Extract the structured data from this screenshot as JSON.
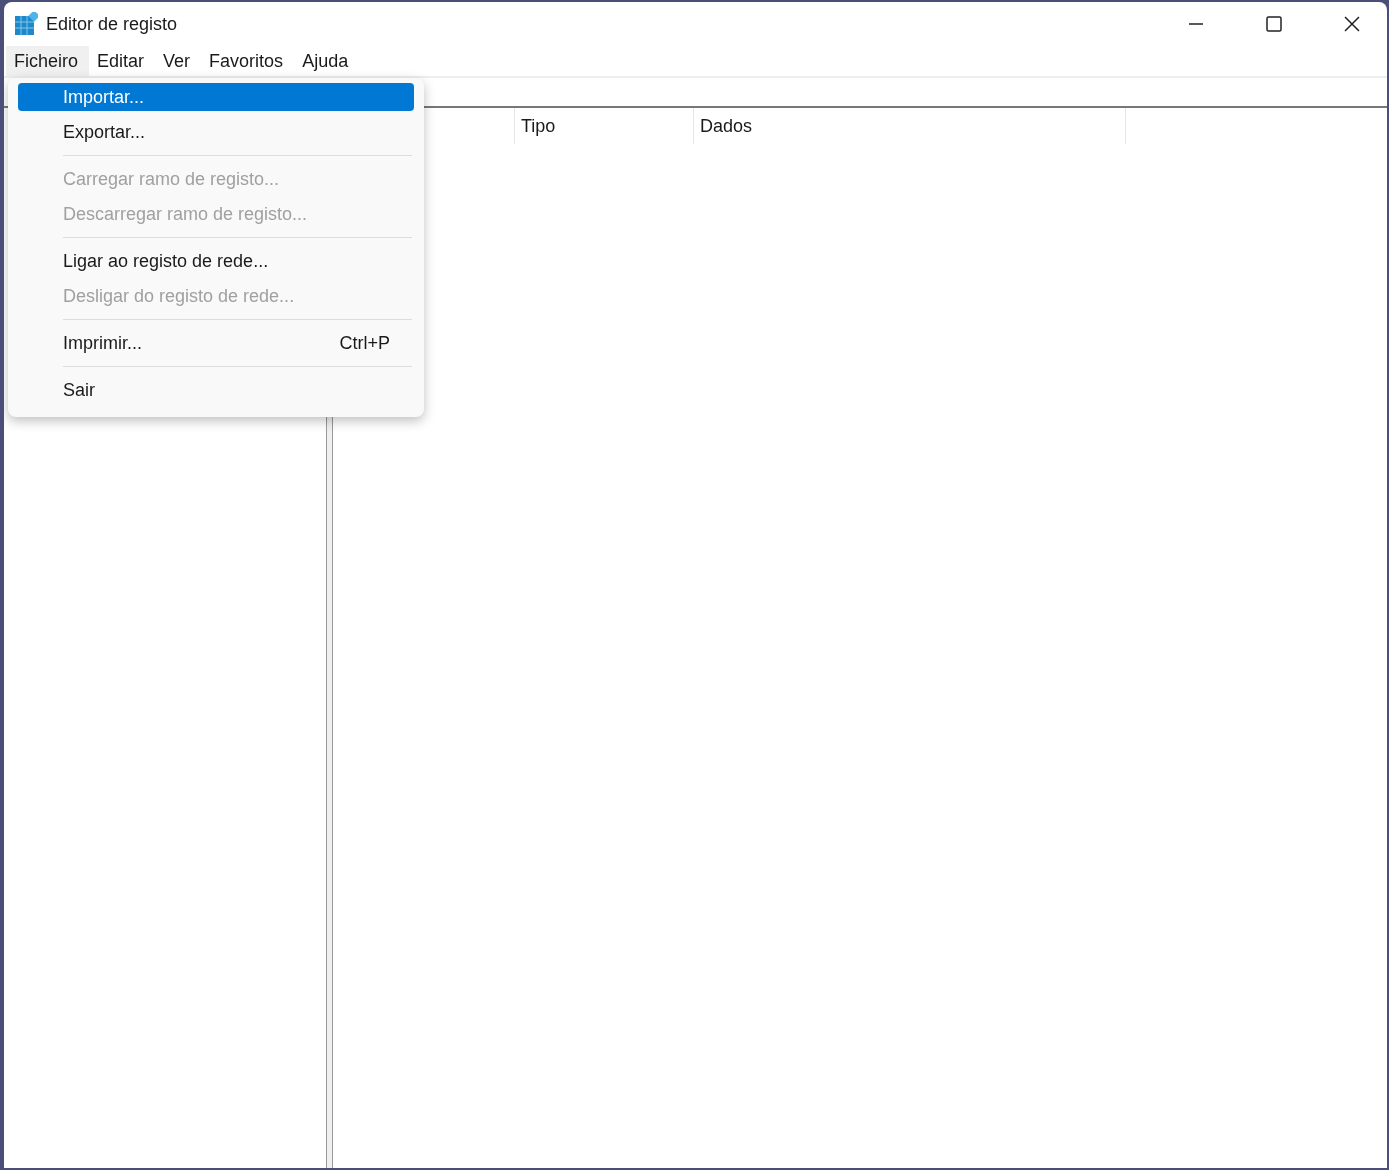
{
  "window": {
    "title": "Editor de registo"
  },
  "menu_bar": [
    {
      "label": "Ficheiro",
      "open": true
    },
    {
      "label": "Editar",
      "open": false
    },
    {
      "label": "Ver",
      "open": false
    },
    {
      "label": "Favoritos",
      "open": false
    },
    {
      "label": "Ajuda",
      "open": false
    }
  ],
  "dropdown_menu": [
    {
      "kind": "item",
      "label": "Importar...",
      "selected": true,
      "disabled": false
    },
    {
      "kind": "item",
      "label": "Exportar...",
      "selected": false,
      "disabled": false
    },
    {
      "kind": "separator"
    },
    {
      "kind": "item",
      "label": "Carregar ramo de registo...",
      "selected": false,
      "disabled": true
    },
    {
      "kind": "item",
      "label": "Descarregar ramo de registo...",
      "selected": false,
      "disabled": true
    },
    {
      "kind": "separator"
    },
    {
      "kind": "item",
      "label": "Ligar ao registo de rede...",
      "selected": false,
      "disabled": false
    },
    {
      "kind": "item",
      "label": "Desligar do registo de rede...",
      "selected": false,
      "disabled": true
    },
    {
      "kind": "separator"
    },
    {
      "kind": "item",
      "label": "Imprimir...",
      "shortcut": "Ctrl+P",
      "selected": false,
      "disabled": false
    },
    {
      "kind": "separator"
    },
    {
      "kind": "item",
      "label": "Sair",
      "selected": false,
      "disabled": false
    }
  ],
  "list_view": {
    "columns": [
      "Tipo",
      "Dados"
    ]
  }
}
